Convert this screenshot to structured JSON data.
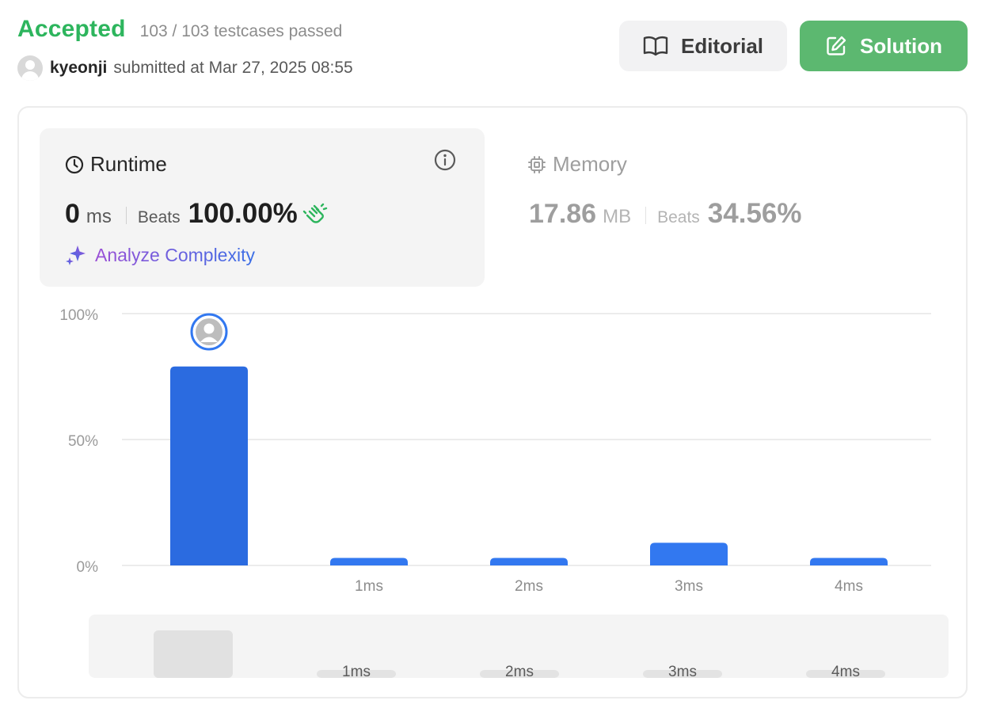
{
  "header": {
    "status": "Accepted",
    "testcases": "103 / 103 testcases passed",
    "username": "kyeonji",
    "submitted_text": "submitted at Mar 27, 2025 08:55",
    "editorial_label": "Editorial",
    "solution_label": "Solution"
  },
  "runtime": {
    "title": "Runtime",
    "value": "0",
    "unit": "ms",
    "beats_label": "Beats",
    "beats_value": "100.00%",
    "analyze_label": "Analyze Complexity"
  },
  "memory": {
    "title": "Memory",
    "value": "17.86",
    "unit": "MB",
    "beats_label": "Beats",
    "beats_value": "34.56%"
  },
  "colors": {
    "accepted": "#2db55d",
    "solution_button": "#5cb870",
    "bar_selected": "#2b6be0",
    "bar": "#3278f0",
    "minimap_bar": "#e3e3e3"
  },
  "chart_data": {
    "type": "bar",
    "categories": [
      "",
      "1ms",
      "2ms",
      "3ms",
      "4ms"
    ],
    "values": [
      79,
      3,
      3,
      9,
      3
    ],
    "selected_index": 0,
    "y_ticks": [
      "100%",
      "50%",
      "0%"
    ],
    "ylim": [
      0,
      100
    ],
    "grid": true,
    "minimap_labels": [
      "",
      "1ms",
      "2ms",
      "3ms",
      "4ms"
    ]
  }
}
